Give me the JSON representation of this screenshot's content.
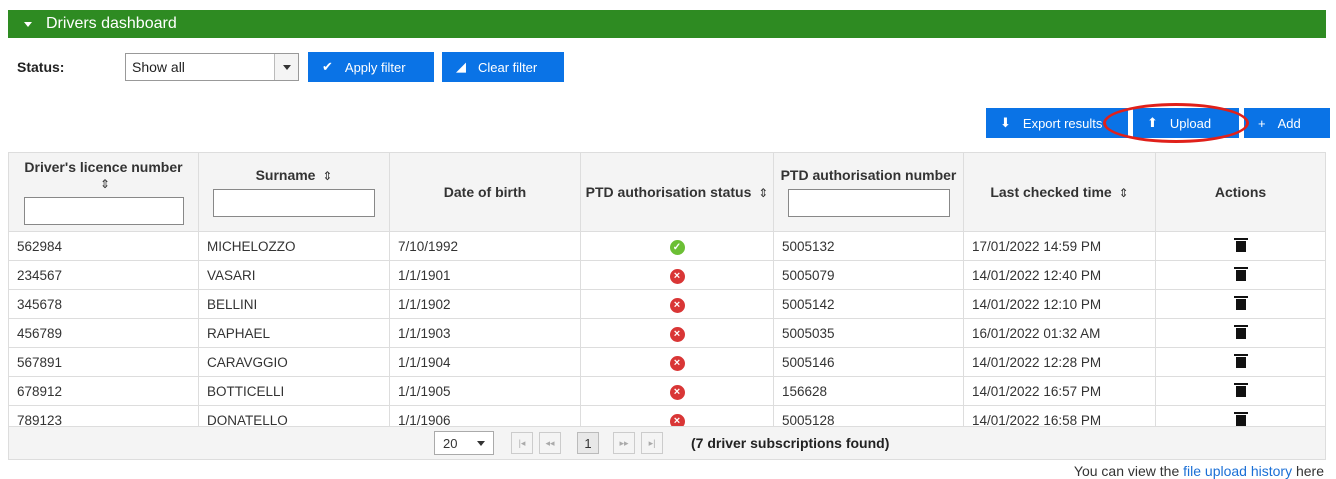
{
  "panel": {
    "title": "Drivers dashboard"
  },
  "filter": {
    "status_label": "Status:",
    "status_value": "Show all",
    "apply_label": "Apply filter",
    "clear_label": "Clear filter"
  },
  "toolbar": {
    "export_label": "Export results",
    "upload_label": "Upload",
    "add_label": "Add"
  },
  "table": {
    "headers": {
      "licence": "Driver's licence number",
      "surname": "Surname",
      "dob": "Date of birth",
      "ptd_status": "PTD authorisation status",
      "ptd_number": "PTD authorisation number",
      "last_checked": "Last checked time",
      "actions": "Actions"
    },
    "rows": [
      {
        "licence": "562984",
        "surname": "MICHELOZZO",
        "dob": "7/10/1992",
        "status": "ok",
        "ptd": "5005132",
        "checked": "17/01/2022 14:59 PM"
      },
      {
        "licence": "234567",
        "surname": "VASARI",
        "dob": "1/1/1901",
        "status": "bad",
        "ptd": "5005079",
        "checked": "14/01/2022 12:40 PM"
      },
      {
        "licence": "345678",
        "surname": "BELLINI",
        "dob": "1/1/1902",
        "status": "bad",
        "ptd": "5005142",
        "checked": "14/01/2022 12:10 PM"
      },
      {
        "licence": "456789",
        "surname": "RAPHAEL",
        "dob": "1/1/1903",
        "status": "bad",
        "ptd": "5005035",
        "checked": "16/01/2022 01:32 AM"
      },
      {
        "licence": "567891",
        "surname": "CARAVGGIO",
        "dob": "1/1/1904",
        "status": "bad",
        "ptd": "5005146",
        "checked": "14/01/2022 12:28 PM"
      },
      {
        "licence": "678912",
        "surname": "BOTTICELLI",
        "dob": "1/1/1905",
        "status": "bad",
        "ptd": "156628",
        "checked": "14/01/2022 16:57 PM"
      },
      {
        "licence": "789123",
        "surname": "DONATELLO",
        "dob": "1/1/1906",
        "status": "bad",
        "ptd": "5005128",
        "checked": "14/01/2022 16:58 PM"
      }
    ]
  },
  "pager": {
    "page_size": "20",
    "current_page": "1",
    "found_text": "(7 driver subscriptions found)"
  },
  "footer": {
    "prefix": "You can view the ",
    "link": "file upload history",
    "suffix": " here"
  },
  "colors": {
    "header_green": "#2e8b22",
    "button_blue": "#0a73e6",
    "highlight_red": "#e0201a"
  }
}
